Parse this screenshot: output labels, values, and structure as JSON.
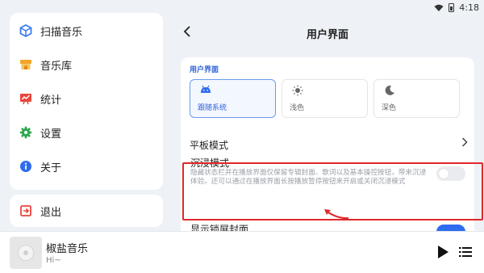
{
  "status_bar": {
    "time": "4:18"
  },
  "sidebar": {
    "items": [
      {
        "label": "扫描音乐",
        "icon": "cube-icon"
      },
      {
        "label": "音乐库",
        "icon": "store-icon"
      },
      {
        "label": "统计",
        "icon": "chart-icon"
      },
      {
        "label": "设置",
        "icon": "gear-icon"
      },
      {
        "label": "关于",
        "icon": "info-icon"
      }
    ],
    "exit_label": "退出"
  },
  "player": {
    "title": "椒盐音乐",
    "subtitle": "Hi~"
  },
  "panel": {
    "title": "用户界面",
    "section": "用户界面",
    "themes": [
      {
        "label": "跟随系统",
        "icon": "android-icon",
        "selected": true
      },
      {
        "label": "浅色",
        "icon": "sun-icon",
        "selected": false
      },
      {
        "label": "深色",
        "icon": "moon-icon",
        "selected": false
      }
    ],
    "tablet_mode": "平板模式",
    "immersive_title": "沉浸模式",
    "immersive_desc": "隐藏状态栏并在播放界面仅保留专辑封面、歌词以及基本操控按钮，带来沉浸体验。还可以通过在播放界面长按播放暂停按钮来开启或关闭沉浸模式",
    "immersive_enabled": false,
    "lockscreen_title": "显示锁屏封面",
    "lockscreen_enabled": true
  },
  "colors": {
    "accent": "#2f6cf0",
    "highlight": "#e02828"
  }
}
